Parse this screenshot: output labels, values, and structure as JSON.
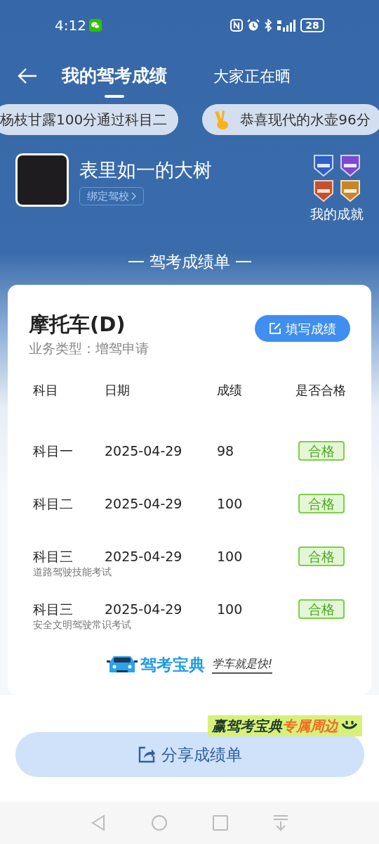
{
  "status_bar": {
    "time": "4:12",
    "battery": "28"
  },
  "tabs": [
    {
      "label": "我的驾考成绩",
      "selected": true
    },
    {
      "label": "大家正在晒",
      "selected": false
    }
  ],
  "ticker": [
    {
      "text": "杨枝甘露100分通过科目二",
      "emoji": false
    },
    {
      "text": "恭喜现代的水壶96分",
      "emoji": true
    }
  ],
  "profile": {
    "name": "表里如一的大树",
    "bind_link": "绑定驾校",
    "achievements_label": "我的成就"
  },
  "section_title": "驾考成绩单",
  "card": {
    "vehicle": "摩托车(D)",
    "business_type": "业务类型：增驾申请",
    "fill_button": "填写成绩",
    "columns": [
      "科目",
      "日期",
      "成绩",
      "是否合格"
    ],
    "rows": [
      {
        "subject": "科目一",
        "note": "",
        "date": "2025-04-29",
        "score": "98",
        "result": "合格",
        "passed": true
      },
      {
        "subject": "科目二",
        "note": "",
        "date": "2025-04-29",
        "score": "100",
        "result": "合格",
        "passed": true
      },
      {
        "subject": "科目三",
        "note": "道路驾驶技能考试",
        "date": "2025-04-29",
        "score": "100",
        "result": "合格",
        "passed": true
      },
      {
        "subject": "科目三",
        "note": "安全文明驾驶常识考试",
        "date": "2025-04-29",
        "score": "100",
        "result": "合格",
        "passed": true
      }
    ],
    "brand": "驾考宝典",
    "slogan": "学车就是快!"
  },
  "promo": {
    "lead": "赢驾考宝典",
    "highlight": "专属周边"
  },
  "share_button": "分享成绩单"
}
